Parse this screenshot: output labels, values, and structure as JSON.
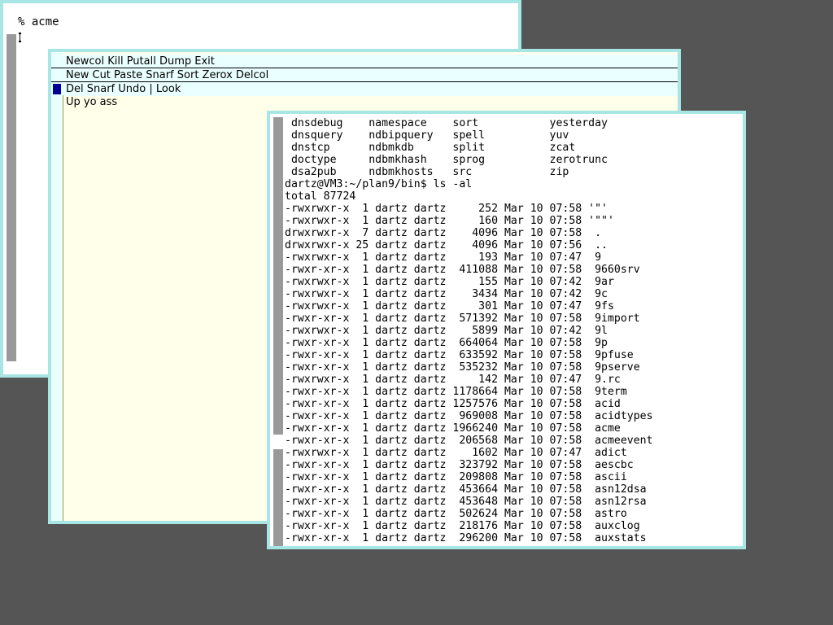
{
  "rc_window": {
    "prompt_text": "% acme"
  },
  "acme": {
    "column_tag": "Newcol Kill Putall Dump Exit",
    "window_tag": "New Cut Paste Snarf Sort Zerox Delcol",
    "file_tag": "Del Snarf Undo | Look",
    "body_text": "Up yo ass"
  },
  "terminal": {
    "lines": [
      " dnsdebug    namespace    sort           yesterday",
      " dnsquery    ndbipquery   spell          yuv",
      " dnstcp      ndbmkdb      split          zcat",
      " doctype     ndbmkhash    sprog          zerotrunc",
      " dsa2pub     ndbmkhosts   src            zip",
      "dartz@VM3:~/plan9/bin$ ls -al",
      "total 87724",
      "-rwxrwxr-x  1 dartz dartz     252 Mar 10 07:58 '\"'",
      "-rwxrwxr-x  1 dartz dartz     160 Mar 10 07:58 '\"\"'",
      "drwxrwxr-x  7 dartz dartz    4096 Mar 10 07:58  .",
      "drwxrwxr-x 25 dartz dartz    4096 Mar 10 07:56  ..",
      "-rwxrwxr-x  1 dartz dartz     193 Mar 10 07:47  9",
      "-rwxr-xr-x  1 dartz dartz  411088 Mar 10 07:58  9660srv",
      "-rwxrwxr-x  1 dartz dartz     155 Mar 10 07:42  9ar",
      "-rwxrwxr-x  1 dartz dartz    3434 Mar 10 07:42  9c",
      "-rwxrwxr-x  1 dartz dartz     301 Mar 10 07:47  9fs",
      "-rwxr-xr-x  1 dartz dartz  571392 Mar 10 07:58  9import",
      "-rwxrwxr-x  1 dartz dartz    5899 Mar 10 07:42  9l",
      "-rwxr-xr-x  1 dartz dartz  664064 Mar 10 07:58  9p",
      "-rwxr-xr-x  1 dartz dartz  633592 Mar 10 07:58  9pfuse",
      "-rwxr-xr-x  1 dartz dartz  535232 Mar 10 07:58  9pserve",
      "-rwxrwxr-x  1 dartz dartz     142 Mar 10 07:47  9.rc",
      "-rwxr-xr-x  1 dartz dartz 1178664 Mar 10 07:58  9term",
      "-rwxr-xr-x  1 dartz dartz 1257576 Mar 10 07:58  acid",
      "-rwxr-xr-x  1 dartz dartz  969008 Mar 10 07:58  acidtypes",
      "-rwxr-xr-x  1 dartz dartz 1966240 Mar 10 07:58  acme",
      "-rwxr-xr-x  1 dartz dartz  206568 Mar 10 07:58  acmeevent",
      "-rwxrwxr-x  1 dartz dartz    1602 Mar 10 07:47  adict",
      "-rwxr-xr-x  1 dartz dartz  323792 Mar 10 07:58  aescbc",
      "-rwxr-xr-x  1 dartz dartz  209808 Mar 10 07:58  ascii",
      "-rwxr-xr-x  1 dartz dartz  453664 Mar 10 07:58  asn12dsa",
      "-rwxr-xr-x  1 dartz dartz  453648 Mar 10 07:58  asn12rsa",
      "-rwxr-xr-x  1 dartz dartz  502624 Mar 10 07:58  astro",
      "-rwxr-xr-x  1 dartz dartz  218176 Mar 10 07:58  auxclog",
      "-rwxr-xr-x  1 dartz dartz  296200 Mar 10 07:58  auxstats"
    ]
  }
}
